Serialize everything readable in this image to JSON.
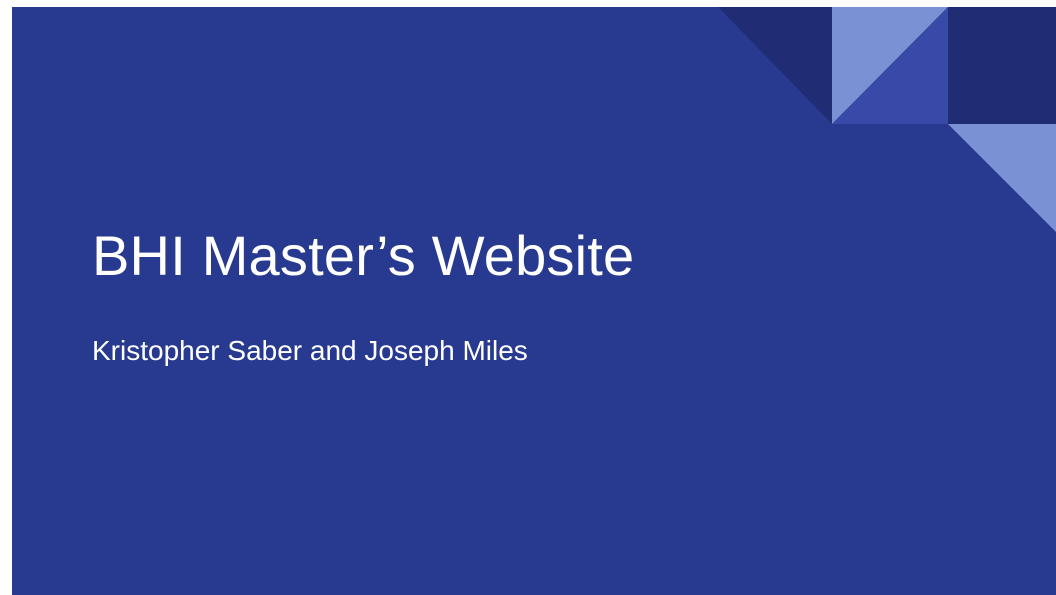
{
  "slide": {
    "title": "BHI Master’s Website",
    "subtitle": "Kristopher Saber and Joseph Miles"
  },
  "colors": {
    "background": "#283a8f",
    "shape_dark": "#202d74",
    "shape_light": "#7a91d3",
    "shape_mid": "#3849a8",
    "text": "#ffffff"
  }
}
